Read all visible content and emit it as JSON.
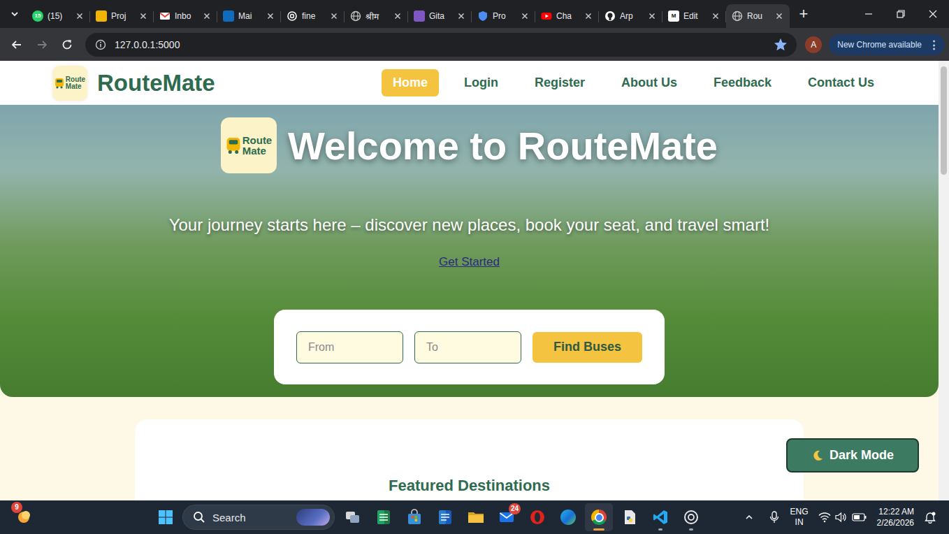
{
  "browser": {
    "tabs": [
      {
        "title": "(15)",
        "icon": "whatsapp",
        "icon_text": "15",
        "selected": false
      },
      {
        "title": "Proj",
        "icon": "slides",
        "icon_text": "",
        "selected": false
      },
      {
        "title": "Inbo",
        "icon": "gmail",
        "icon_text": "",
        "selected": false
      },
      {
        "title": "Mai",
        "icon": "outlook",
        "icon_text": "",
        "selected": false
      },
      {
        "title": "fine",
        "icon": "chatgpt",
        "icon_text": "",
        "selected": false
      },
      {
        "title": "श्रीम",
        "icon": "globe",
        "icon_text": "",
        "selected": false
      },
      {
        "title": "Gita",
        "icon": "gita",
        "icon_text": "",
        "selected": false
      },
      {
        "title": "Pro",
        "icon": "shield",
        "icon_text": "",
        "selected": false
      },
      {
        "title": "Cha",
        "icon": "youtube",
        "icon_text": "",
        "selected": false
      },
      {
        "title": "Arp",
        "icon": "github",
        "icon_text": "",
        "selected": false
      },
      {
        "title": "Edit",
        "icon": "medium",
        "icon_text": "M",
        "selected": false
      },
      {
        "title": "Rou",
        "icon": "globe",
        "icon_text": "",
        "selected": true
      }
    ],
    "new_tab": "+",
    "back_enabled": true,
    "forward_enabled": false,
    "address": "127.0.0.1:5000",
    "bookmarked": true,
    "profile": "A",
    "update_notice": "New Chrome available",
    "menu": "⋮"
  },
  "site": {
    "logo": [
      "Route",
      "Mate"
    ],
    "brand": "RouteMate",
    "nav": [
      {
        "label": "Home",
        "selected": true
      },
      {
        "label": "Login",
        "selected": false
      },
      {
        "label": "Register",
        "selected": false
      },
      {
        "label": "About Us",
        "selected": false
      },
      {
        "label": "Feedback",
        "selected": false
      },
      {
        "label": "Contact Us",
        "selected": false
      }
    ],
    "hero": {
      "logo": [
        "Route",
        "Mate"
      ],
      "title": "Welcome to RouteMate",
      "subtitle": "Your journey starts here – discover new places, book your seat, and travel smart!",
      "cta": "Get Started",
      "search": {
        "from_placeholder": "From",
        "to_placeholder": "To",
        "button": "Find Buses"
      }
    },
    "section_title": "Featured Destinations",
    "theme_toggle": "Dark Mode"
  },
  "taskbar": {
    "weather_badge": "9",
    "search_placeholder": "Search",
    "apps": [
      {
        "kind": "taskview",
        "running": false,
        "selected": false,
        "badge": ""
      },
      {
        "kind": "excel",
        "running": false,
        "selected": false,
        "badge": ""
      },
      {
        "kind": "store",
        "running": false,
        "selected": false,
        "badge": ""
      },
      {
        "kind": "word",
        "running": false,
        "selected": false,
        "badge": ""
      },
      {
        "kind": "explorer",
        "running": false,
        "selected": false,
        "badge": ""
      },
      {
        "kind": "mail",
        "running": false,
        "selected": false,
        "badge": "24"
      },
      {
        "kind": "opera",
        "running": false,
        "selected": false,
        "badge": ""
      },
      {
        "kind": "edge",
        "running": false,
        "selected": false,
        "badge": ""
      },
      {
        "kind": "chrome",
        "running": true,
        "selected": true,
        "badge": ""
      },
      {
        "kind": "python",
        "running": false,
        "selected": false,
        "badge": ""
      },
      {
        "kind": "vscode",
        "running": true,
        "selected": false,
        "badge": ""
      },
      {
        "kind": "chatgpt",
        "running": true,
        "selected": false,
        "badge": ""
      }
    ],
    "language": [
      "ENG",
      "IN"
    ],
    "time": "12:22 AM",
    "date": "2/26/2026"
  }
}
